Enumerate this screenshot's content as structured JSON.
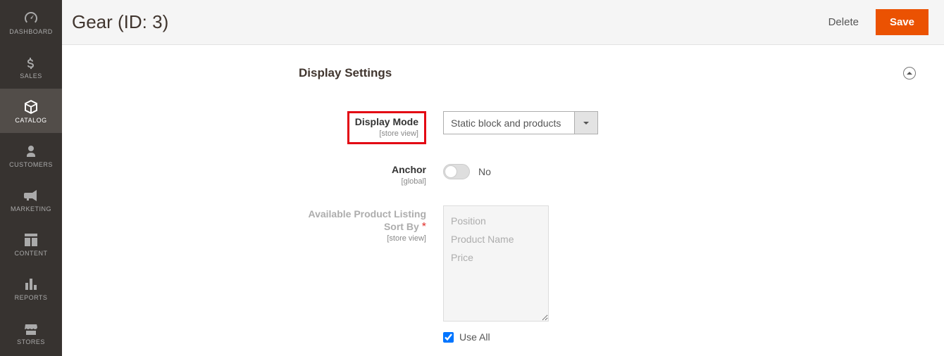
{
  "sidebar": {
    "items": [
      {
        "label": "DASHBOARD"
      },
      {
        "label": "SALES"
      },
      {
        "label": "CATALOG"
      },
      {
        "label": "CUSTOMERS"
      },
      {
        "label": "MARKETING"
      },
      {
        "label": "CONTENT"
      },
      {
        "label": "REPORTS"
      },
      {
        "label": "STORES"
      }
    ]
  },
  "header": {
    "title": "Gear (ID: 3)",
    "delete": "Delete",
    "save": "Save"
  },
  "section": {
    "title": "Display Settings"
  },
  "form": {
    "displayMode": {
      "label": "Display Mode",
      "scope": "[store view]",
      "value": "Static block and products"
    },
    "anchor": {
      "label": "Anchor",
      "scope": "[global]",
      "value": "No"
    },
    "sortBy": {
      "label": "Available Product Listing Sort By",
      "scope": "[store view]",
      "options": [
        "Position",
        "Product Name",
        "Price"
      ],
      "useAll": "Use All"
    }
  }
}
